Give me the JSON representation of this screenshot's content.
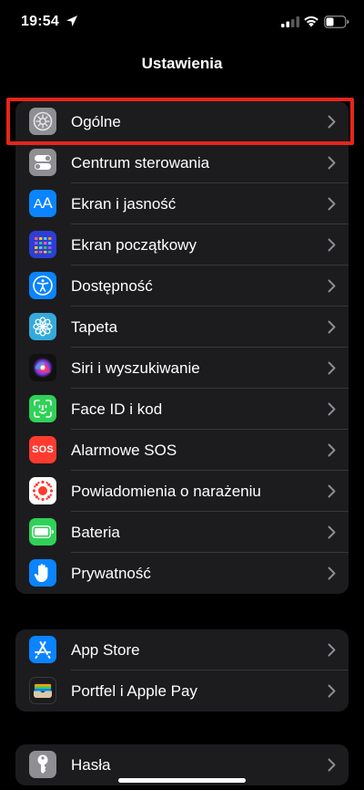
{
  "status": {
    "time": "19:54"
  },
  "title": "Ustawienia",
  "group1": [
    {
      "label": "Ogólne",
      "icon": "gear-icon",
      "color": "#8e8e93"
    },
    {
      "label": "Centrum sterowania",
      "icon": "toggles-icon",
      "color": "#8e8e93"
    },
    {
      "label": "Ekran i jasność",
      "icon": "text-size-icon",
      "color": "#0a84ff"
    },
    {
      "label": "Ekran początkowy",
      "icon": "home-grid-icon",
      "color": "#2c3ed6"
    },
    {
      "label": "Dostępność",
      "icon": "accessibility-icon",
      "color": "#0a84ff"
    },
    {
      "label": "Tapeta",
      "icon": "flower-icon",
      "color": "#34aadc"
    },
    {
      "label": "Siri i wyszukiwanie",
      "icon": "siri-icon",
      "color": "#111111"
    },
    {
      "label": "Face ID i kod",
      "icon": "face-id-icon",
      "color": "#30d158"
    },
    {
      "label": "Alarmowe SOS",
      "icon": "sos-icon",
      "color": "#ff3b30",
      "badge": "SOS"
    },
    {
      "label": "Powiadomienia o narażeniu",
      "icon": "exposure-icon",
      "color": "#ffffff"
    },
    {
      "label": "Bateria",
      "icon": "battery-icon",
      "color": "#30d158"
    },
    {
      "label": "Prywatność",
      "icon": "hand-icon",
      "color": "#0a84ff"
    }
  ],
  "group2": [
    {
      "label": "App Store",
      "icon": "app-store-icon",
      "color": "#0a84ff"
    },
    {
      "label": "Portfel i Apple Pay",
      "icon": "wallet-icon",
      "color": "#1c1c1e"
    }
  ],
  "group3": [
    {
      "label": "Hasła",
      "icon": "key-icon",
      "color": "#8e8e93"
    }
  ],
  "accent": "#e8241c"
}
